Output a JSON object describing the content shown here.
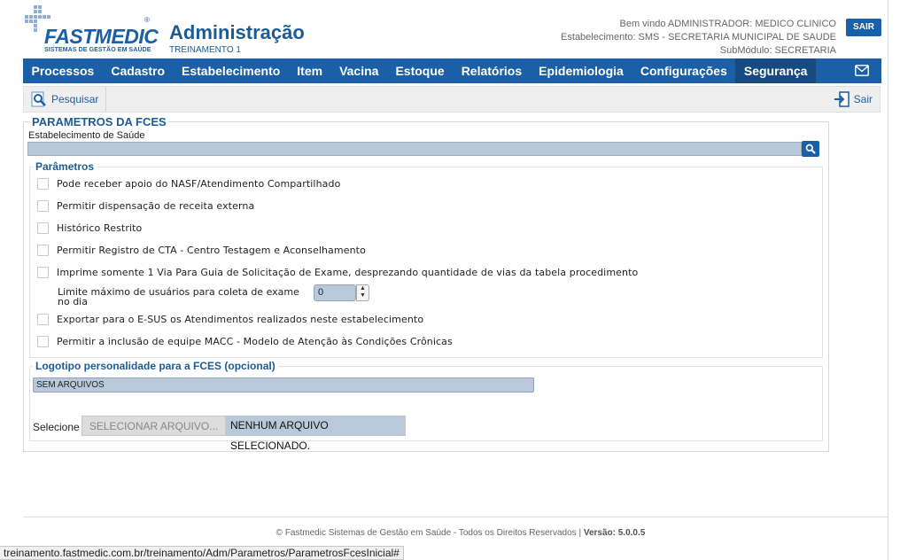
{
  "header": {
    "brand": "FASTMEDIC",
    "brand_reg": "®",
    "tagline": "SISTEMAS DE GESTÃO EM SAÚDE",
    "title": "Administração",
    "subtitle": "TREINAMENTO 1",
    "welcome": "Bem vindo ADMINISTRADOR: MEDICO CLINICO",
    "establishment": "Estabelecimento: SMS - SECRETARIA MUNICIPAL DE SAUDE",
    "submodule": "SubMódulo: SECRETARIA",
    "logout_label": "SAIR"
  },
  "nav": {
    "items": [
      "Processos",
      "Cadastro",
      "Estabelecimento",
      "Item",
      "Vacina",
      "Estoque",
      "Relatórios",
      "Epidemiologia",
      "Configurações",
      "Segurança"
    ],
    "active": "Segurança"
  },
  "toolbar": {
    "search_label": "Pesquisar",
    "exit_label": "Sair"
  },
  "form": {
    "title": "PARAMETROS DA FCES",
    "estab_label": "Estabelecimento de Saúde",
    "estab_value": "",
    "params_legend": "Parâmetros",
    "options": [
      {
        "label": "Pode receber apoio do NASF/Atendimento Compartilhado",
        "checked": false
      },
      {
        "label": "Permitir dispensação de receita externa",
        "checked": false
      },
      {
        "label": "Histórico Restrito",
        "checked": false
      },
      {
        "label": "Permitir Registro de CTA - Centro Testagem e Aconselhamento",
        "checked": false
      },
      {
        "label": "Imprime somente 1 Via Para Guia de Solicitação de Exame, desprezando quantidade de vias da tabela procedimento",
        "checked": false
      },
      {
        "label": "Exportar para o E-SUS os Atendimentos realizados neste estabelecimento",
        "checked": false
      },
      {
        "label": "Permitir a inclusão de equipe MACC - Modelo de Atenção às Condições Crônicas",
        "checked": false
      }
    ],
    "limit_label": "Limite máximo de usuários para coleta de exame no dia",
    "limit_value": "0",
    "logo_legend": "Logotipo personalidade para a FCES (opcional)",
    "files_value": "SEM ARQUIVOS",
    "select_label": "Selecione",
    "select_button": "SELECIONAR ARQUIVO...",
    "no_file": "NENHUM ARQUIVO SELECIONADO."
  },
  "footer": {
    "text": "© Fastmedic Sistemas de Gestão em Saúde - Todos os Direitos Reservados |",
    "version": "Versão: 5.0.0.5"
  },
  "statusbar": {
    "url": "treinamento.fastmedic.com.br/treinamento/Adm/Parametros/ParametrosFcesInicial#"
  },
  "colors": {
    "brand_blue": "#1b5fa6",
    "input_bg": "#b9c9d9"
  }
}
